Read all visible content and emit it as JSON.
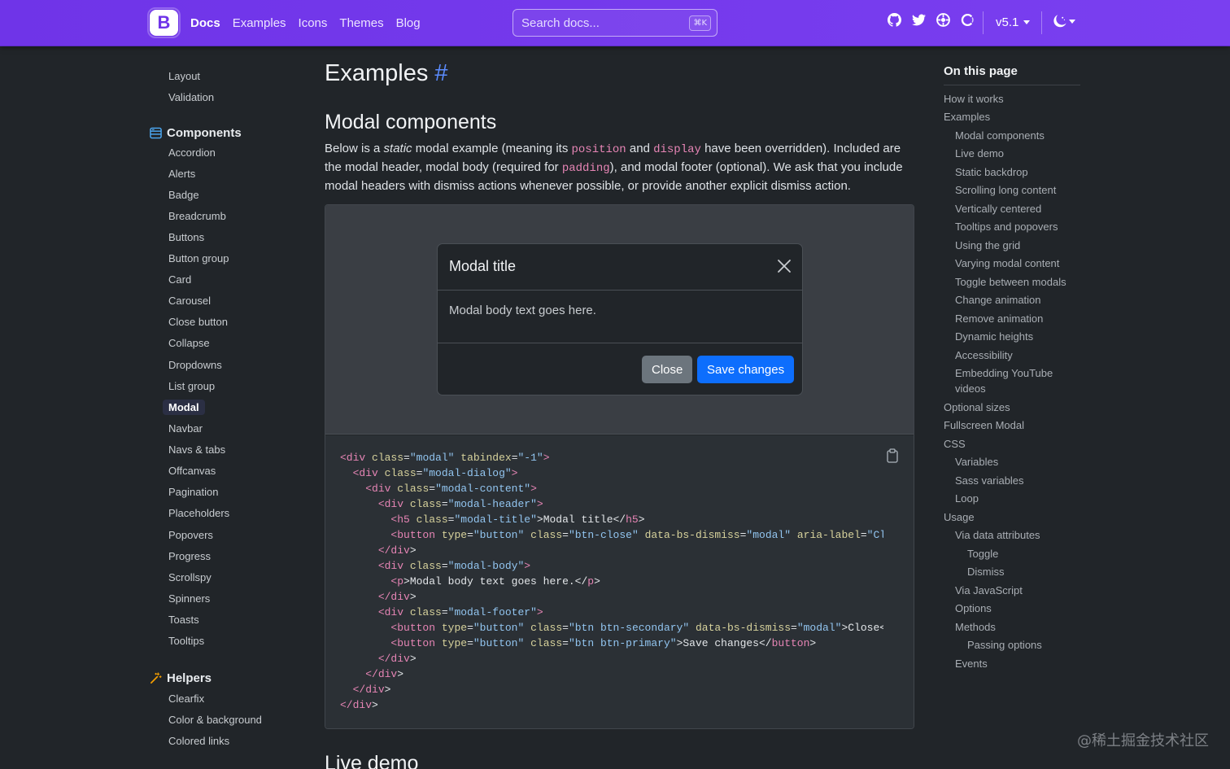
{
  "navbar": {
    "brand_letter": "B",
    "links": [
      "Docs",
      "Examples",
      "Icons",
      "Themes",
      "Blog"
    ],
    "search_placeholder": "Search docs...",
    "search_shortcut": "⌘K",
    "version": "v5.1"
  },
  "sidebar": {
    "items_top": [
      "Layout",
      "Validation"
    ],
    "components_label": "Components",
    "components": [
      "Accordion",
      "Alerts",
      "Badge",
      "Breadcrumb",
      "Buttons",
      "Button group",
      "Card",
      "Carousel",
      "Close button",
      "Collapse",
      "Dropdowns",
      "List group",
      "Modal",
      "Navbar",
      "Navs & tabs",
      "Offcanvas",
      "Pagination",
      "Placeholders",
      "Popovers",
      "Progress",
      "Scrollspy",
      "Spinners",
      "Toasts",
      "Tooltips"
    ],
    "helpers_label": "Helpers",
    "helpers": [
      "Clearfix",
      "Color & background",
      "Colored links"
    ]
  },
  "main": {
    "title": "Examples",
    "hash": "#",
    "section_title": "Modal components",
    "lead": {
      "p1": "Below is a ",
      "em": "static",
      "p2": " modal example (meaning its ",
      "c1": "position",
      "p3": " and ",
      "c2": "display",
      "p4": " have been overridden). Included are the modal header, modal body (required for ",
      "c3": "padding",
      "p5": "), and modal footer (optional). We ask that you include modal headers with dismiss actions whenever possible, or provide another explicit dismiss action."
    },
    "modal": {
      "title": "Modal title",
      "body": "Modal body text goes here.",
      "close_label": "Close",
      "save_label": "Save changes"
    },
    "next_section": "Live demo"
  },
  "toc": {
    "title": "On this page",
    "items": [
      {
        "label": "How it works",
        "level": 1
      },
      {
        "label": "Examples",
        "level": 1
      },
      {
        "label": "Modal components",
        "level": 2
      },
      {
        "label": "Live demo",
        "level": 2
      },
      {
        "label": "Static backdrop",
        "level": 2
      },
      {
        "label": "Scrolling long content",
        "level": 2
      },
      {
        "label": "Vertically centered",
        "level": 2
      },
      {
        "label": "Tooltips and popovers",
        "level": 2
      },
      {
        "label": "Using the grid",
        "level": 2
      },
      {
        "label": "Varying modal content",
        "level": 2
      },
      {
        "label": "Toggle between modals",
        "level": 2
      },
      {
        "label": "Change animation",
        "level": 2
      },
      {
        "label": "Remove animation",
        "level": 2
      },
      {
        "label": "Dynamic heights",
        "level": 2
      },
      {
        "label": "Accessibility",
        "level": 2
      },
      {
        "label": "Embedding YouTube",
        "level": 2
      },
      {
        "label": "videos",
        "level": 2
      },
      {
        "label": "Optional sizes",
        "level": 1
      },
      {
        "label": "Fullscreen Modal",
        "level": 1
      },
      {
        "label": "CSS",
        "level": 1
      },
      {
        "label": "Variables",
        "level": 2
      },
      {
        "label": "Sass variables",
        "level": 2
      },
      {
        "label": "Loop",
        "level": 2
      },
      {
        "label": "Usage",
        "level": 1
      },
      {
        "label": "Via data attributes",
        "level": 2
      },
      {
        "label": "Toggle",
        "level": 3
      },
      {
        "label": "Dismiss",
        "level": 3
      },
      {
        "label": "Via JavaScript",
        "level": 2
      },
      {
        "label": "Options",
        "level": 2
      },
      {
        "label": "Methods",
        "level": 2
      },
      {
        "label": "Passing options",
        "level": 3
      },
      {
        "label": "Events",
        "level": 2
      }
    ]
  },
  "code_lines": [
    [
      [
        "t",
        "<div "
      ],
      [
        "a",
        "class"
      ],
      [
        "p",
        "="
      ],
      [
        "s",
        "\"modal\""
      ],
      [
        "p",
        " "
      ],
      [
        "a",
        "tabindex"
      ],
      [
        "p",
        "="
      ],
      [
        "s",
        "\"-1\""
      ],
      [
        "t",
        ">"
      ]
    ],
    [
      [
        "p",
        "  "
      ],
      [
        "t",
        "<div "
      ],
      [
        "a",
        "class"
      ],
      [
        "p",
        "="
      ],
      [
        "s",
        "\"modal-dialog\""
      ],
      [
        "t",
        ">"
      ]
    ],
    [
      [
        "p",
        "    "
      ],
      [
        "t",
        "<div "
      ],
      [
        "a",
        "class"
      ],
      [
        "p",
        "="
      ],
      [
        "s",
        "\"modal-content\""
      ],
      [
        "t",
        ">"
      ]
    ],
    [
      [
        "p",
        "      "
      ],
      [
        "t",
        "<div "
      ],
      [
        "a",
        "class"
      ],
      [
        "p",
        "="
      ],
      [
        "s",
        "\"modal-header\""
      ],
      [
        "t",
        ">"
      ]
    ],
    [
      [
        "p",
        "        "
      ],
      [
        "t",
        "<h5 "
      ],
      [
        "a",
        "class"
      ],
      [
        "p",
        "="
      ],
      [
        "s",
        "\"modal-title\""
      ],
      [
        "p",
        ">Modal title</"
      ],
      [
        "t",
        "h5"
      ],
      [
        "p",
        ">"
      ]
    ],
    [
      [
        "p",
        "        "
      ],
      [
        "t",
        "<button "
      ],
      [
        "a",
        "type"
      ],
      [
        "p",
        "="
      ],
      [
        "s",
        "\"button\""
      ],
      [
        "p",
        " "
      ],
      [
        "a",
        "class"
      ],
      [
        "p",
        "="
      ],
      [
        "s",
        "\"btn-close\""
      ],
      [
        "p",
        " "
      ],
      [
        "a",
        "data-bs-dismiss"
      ],
      [
        "p",
        "="
      ],
      [
        "s",
        "\"modal\""
      ],
      [
        "p",
        " "
      ],
      [
        "a",
        "aria-label"
      ],
      [
        "p",
        "="
      ],
      [
        "s",
        "\"Close\"></button>"
      ]
    ],
    [
      [
        "p",
        "      "
      ],
      [
        "t",
        "</div"
      ],
      [
        "p",
        ">"
      ]
    ],
    [
      [
        "p",
        "      "
      ],
      [
        "t",
        "<div "
      ],
      [
        "a",
        "class"
      ],
      [
        "p",
        "="
      ],
      [
        "s",
        "\"modal-body\""
      ],
      [
        "t",
        ">"
      ]
    ],
    [
      [
        "p",
        "        "
      ],
      [
        "t",
        "<p"
      ],
      [
        "p",
        ">Modal body text goes here.</"
      ],
      [
        "t",
        "p"
      ],
      [
        "p",
        ">"
      ]
    ],
    [
      [
        "p",
        "      "
      ],
      [
        "t",
        "</div"
      ],
      [
        "p",
        ">"
      ]
    ],
    [
      [
        "p",
        "      "
      ],
      [
        "t",
        "<div "
      ],
      [
        "a",
        "class"
      ],
      [
        "p",
        "="
      ],
      [
        "s",
        "\"modal-footer\""
      ],
      [
        "t",
        ">"
      ]
    ],
    [
      [
        "p",
        "        "
      ],
      [
        "t",
        "<button "
      ],
      [
        "a",
        "type"
      ],
      [
        "p",
        "="
      ],
      [
        "s",
        "\"button\""
      ],
      [
        "p",
        " "
      ],
      [
        "a",
        "class"
      ],
      [
        "p",
        "="
      ],
      [
        "s",
        "\"btn btn-secondary\""
      ],
      [
        "p",
        " "
      ],
      [
        "a",
        "data-bs-dismiss"
      ],
      [
        "p",
        "="
      ],
      [
        "s",
        "\"modal\""
      ],
      [
        "p",
        ">Close</button>"
      ]
    ],
    [
      [
        "p",
        "        "
      ],
      [
        "t",
        "<button "
      ],
      [
        "a",
        "type"
      ],
      [
        "p",
        "="
      ],
      [
        "s",
        "\"button\""
      ],
      [
        "p",
        " "
      ],
      [
        "a",
        "class"
      ],
      [
        "p",
        "="
      ],
      [
        "s",
        "\"btn btn-primary\""
      ],
      [
        "p",
        ">Save changes</"
      ],
      [
        "t",
        "button"
      ],
      [
        "p",
        ">"
      ]
    ],
    [
      [
        "p",
        "      "
      ],
      [
        "t",
        "</div"
      ],
      [
        "p",
        ">"
      ]
    ],
    [
      [
        "p",
        "    "
      ],
      [
        "t",
        "</div"
      ],
      [
        "p",
        ">"
      ]
    ],
    [
      [
        "p",
        "  "
      ],
      [
        "t",
        "</div"
      ],
      [
        "p",
        ">"
      ]
    ],
    [
      [
        "t",
        "</div"
      ],
      [
        "p",
        ">"
      ]
    ]
  ],
  "watermark": "@稀土掘金技术社区",
  "icons": {
    "brand": "bootstrap-logo-icon",
    "github": "github-icon",
    "twitter": "twitter-icon",
    "opencollective": "opencollective-icon",
    "theme": "moon-icon",
    "components": "components-icon",
    "helpers": "magic-wand-icon",
    "close": "close-icon",
    "clipboard": "clipboard-icon"
  },
  "colors": {
    "navbar": "#7a3ff0",
    "primary": "#0d6efd",
    "secondary": "#6c757d",
    "accent_link": "#5b8cff"
  }
}
